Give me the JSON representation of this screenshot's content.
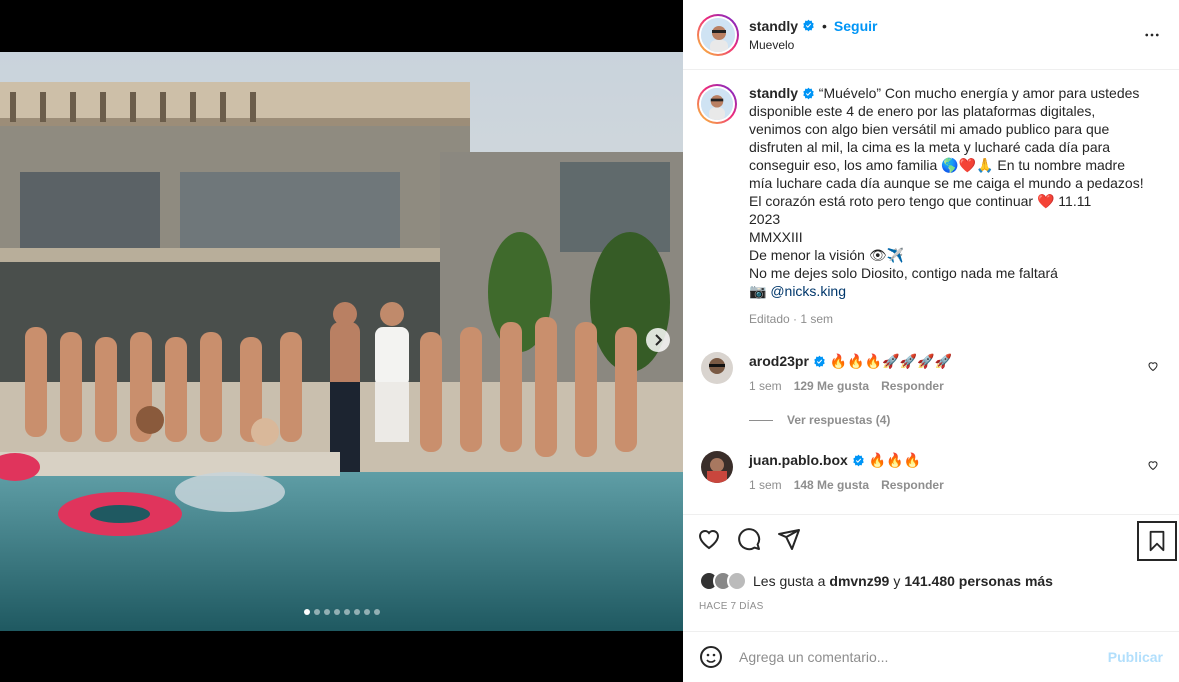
{
  "post": {
    "author": "standly",
    "follow_label": "Seguir",
    "separator": "•",
    "audio_label": "Muevelo",
    "carousel": {
      "count": 8,
      "active_index": 0
    }
  },
  "caption": {
    "username": "standly",
    "text": "“Muévelo” Con mucho energía y amor para ustedes disponible este 4 de enero por las plataformas digitales, venimos con algo bien versátil mi amado publico para que disfruten al mil, la cima es la meta y lucharé cada día para conseguir eso, los amo familia 🌎❤️🙏 En tu nombre madre mía luchare cada día aunque se me caiga el mundo a pedazos! El corazón está roto pero tengo que continuar ❤️ 11.11\n2023\nMMXXIII\nDe menor la visión 👁✈️\nNo me dejes solo Diosito, contigo nada me faltará\n📷 ",
    "mention": "@nicks.king",
    "edited": "Editado · 1 sem"
  },
  "comments": [
    {
      "username": "arod23pr",
      "text": "🔥🔥🔥🚀🚀🚀🚀",
      "time": "1 sem",
      "likes": "129 Me gusta",
      "reply": "Responder"
    },
    {
      "username": "juan.pablo.box",
      "text": "🔥🔥🔥",
      "time": "1 sem",
      "likes": "148 Me gusta",
      "reply": "Responder"
    }
  ],
  "view_replies": "Ver respuestas (4)",
  "likes": {
    "prefix": "Les gusta a",
    "user": "dmvnz99",
    "mid": "y",
    "count": "141.480 personas más"
  },
  "timestamp": "HACE 7 DÍAS",
  "add_comment": {
    "placeholder": "Agrega un comentario...",
    "publish": "Publicar"
  },
  "colors": {
    "accent": "#0095f6",
    "verified": "#0095f6",
    "publish_disabled": "#b2dffc",
    "text": "#262626",
    "muted": "#8e8e8e"
  }
}
